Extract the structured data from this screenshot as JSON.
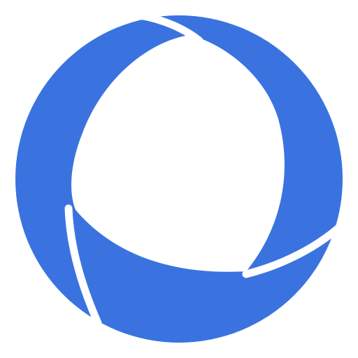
{
  "logo": {
    "icon": "ring-swirl-logo-icon",
    "brand_color": "#3A73E0",
    "background_color": "#FFFFFF"
  }
}
